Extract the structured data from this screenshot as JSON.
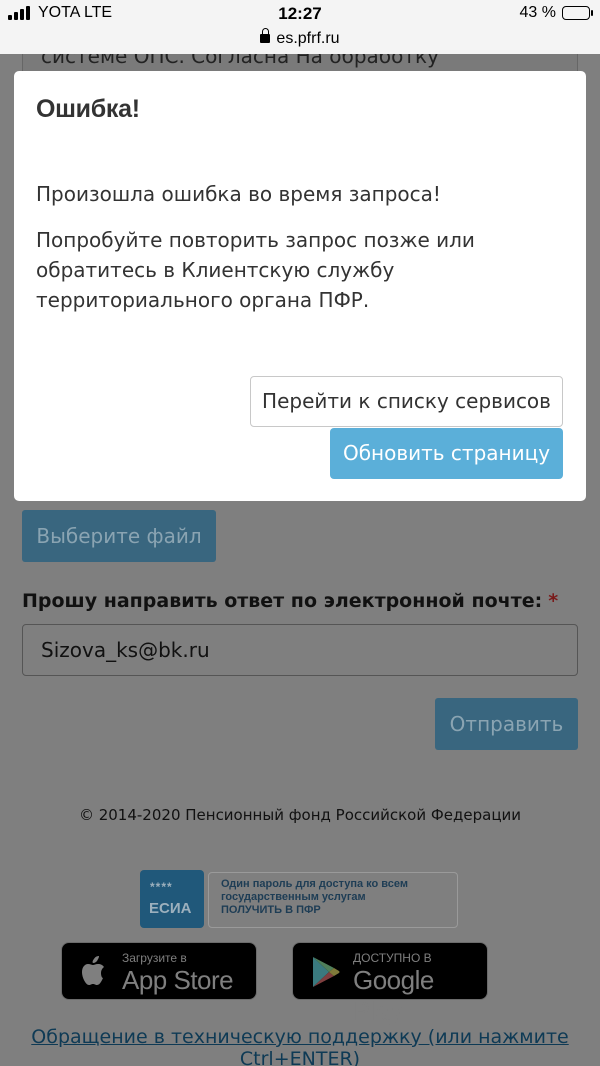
{
  "status_bar": {
    "carrier": "YOTA LTE",
    "time": "12:27",
    "battery_percent": "43 %",
    "battery_level": 0.43,
    "url": "es.pfrf.ru"
  },
  "page": {
    "consent_text_partial": "системе ОПС. Согласна На обработку",
    "file_button_label": "Выберите файл",
    "email_label": "Прошу направить ответ по электронной почте:",
    "required_mark": "*",
    "email_value": "Sizova_ks@bk.ru",
    "send_button_label": "Отправить",
    "copyright": "© 2014-2020 Пенсионный фонд Российской Федерации",
    "esia": {
      "logo_stars": "****",
      "logo_text": "ЕСИА",
      "line1": "Один пароль для доступа ко всем",
      "line2": "государственным услугам",
      "line3": "ПОЛУЧИТЬ В ПФР"
    },
    "app_store": {
      "small": "Загрузите в",
      "big": "App Store",
      "icon": "apple-icon"
    },
    "google_play": {
      "small": "ДОСТУПНО В",
      "big": "Google Play",
      "icon": "google-play-icon"
    },
    "support_link": "Обращение в техническую поддержку (или нажмите Ctrl+ENTER)"
  },
  "modal": {
    "title": "Ошибка!",
    "message1": "Произошла ошибка во время запроса!",
    "message2": "Попробуйте повторить запрос позже или обратитесь в Клиентскую службу территориального органа ПФР.",
    "button_services": "Перейти к списку сервисов",
    "button_refresh": "Обновить страницу"
  },
  "colors": {
    "primary_button": "#5bafd9",
    "overlay": "#7f7f7f",
    "modal_bg": "#ffffff",
    "required": "#c0392b"
  }
}
